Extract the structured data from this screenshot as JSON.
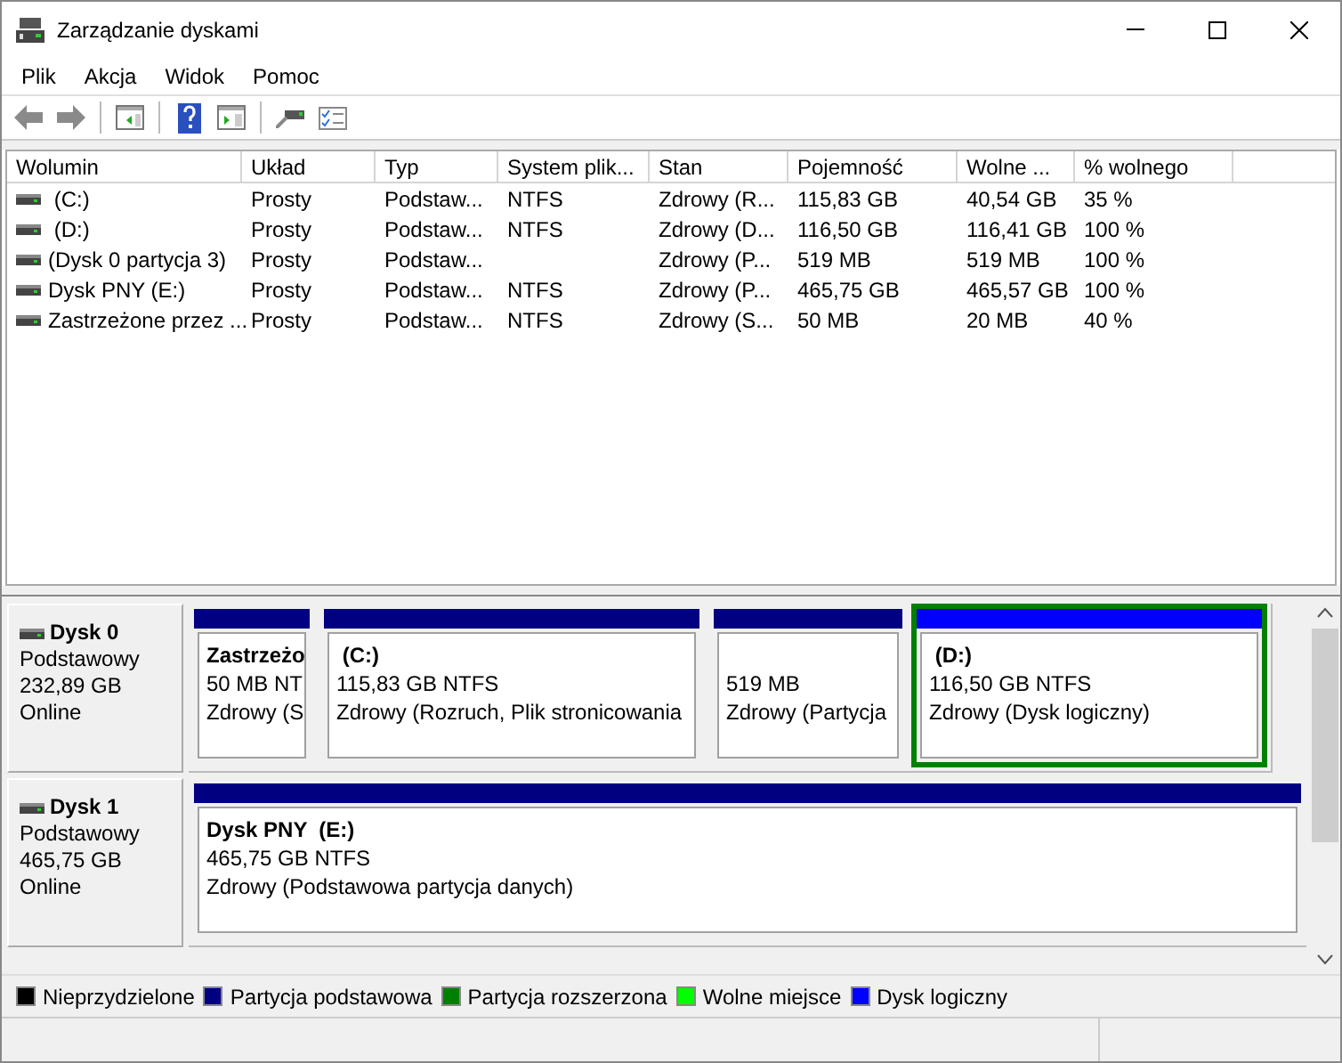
{
  "window": {
    "title": "Zarządzanie dyskami"
  },
  "menu": [
    "Plik",
    "Akcja",
    "Widok",
    "Pomoc"
  ],
  "table": {
    "columns": [
      "Wolumin",
      "Układ",
      "Typ",
      "System plik...",
      "Stan",
      "Pojemność",
      "Wolne ...",
      "% wolnego"
    ],
    "rows": [
      {
        "volume": " (C:)",
        "layout": "Prosty",
        "type": "Podstaw...",
        "file_system": "NTFS",
        "status": "Zdrowy (R...",
        "capacity": "115,83 GB",
        "free": "40,54 GB",
        "free_percent": "35 %"
      },
      {
        "volume": " (D:)",
        "layout": "Prosty",
        "type": "Podstaw...",
        "file_system": "NTFS",
        "status": "Zdrowy (D...",
        "capacity": "116,50 GB",
        "free": "116,41 GB",
        "free_percent": "100 %"
      },
      {
        "volume": "(Dysk 0 partycja 3)",
        "layout": "Prosty",
        "type": "Podstaw...",
        "status": "Zdrowy (P...",
        "capacity": "519 MB",
        "free": "519 MB",
        "free_percent": "100 %"
      },
      {
        "volume": "Dysk PNY (E:)",
        "layout": "Prosty",
        "type": "Podstaw...",
        "file_system": "NTFS",
        "status": "Zdrowy (P...",
        "capacity": "465,75 GB",
        "free": "465,57 GB",
        "free_percent": "100 %"
      },
      {
        "volume": "Zastrzeżone przez ...",
        "layout": "Prosty",
        "type": "Podstaw...",
        "file_system": "NTFS",
        "status": "Zdrowy (S...",
        "capacity": "50 MB",
        "free": "20 MB",
        "free_percent": "40 %"
      }
    ]
  },
  "disks": [
    {
      "name": "Dysk 0",
      "type": "Podstawowy",
      "size": "232,89 GB",
      "status": "Online",
      "partitions": [
        {
          "label": "Zastrzeżo",
          "size": "50 MB NT",
          "status": "Zdrowy (S",
          "color": "#000080",
          "selected": false
        },
        {
          "label": " (C:)",
          "size": "115,83 GB NTFS",
          "status": "Zdrowy (Rozruch, Plik stronicowania",
          "color": "#000080",
          "selected": false
        },
        {
          "size": "519 MB",
          "status": "Zdrowy (Partycja",
          "color": "#000080",
          "selected": false
        },
        {
          "label": " (D:)",
          "size": "116,50 GB NTFS",
          "status": "Zdrowy (Dysk logiczny)",
          "color": "#0000ff",
          "selected": true
        }
      ]
    },
    {
      "name": "Dysk 1",
      "type": "Podstawowy",
      "size": "465,75 GB",
      "status": "Online",
      "partitions": [
        {
          "label": "Dysk PNY  (E:)",
          "size": "465,75 GB NTFS",
          "status": "Zdrowy (Podstawowa partycja danych)",
          "color": "#000080",
          "selected": false
        }
      ]
    }
  ],
  "legend": [
    {
      "label": "Nieprzydzielone",
      "color": "#000000"
    },
    {
      "label": "Partycja podstawowa",
      "color": "#000080"
    },
    {
      "label": "Partycja rozszerzona",
      "color": "#008000"
    },
    {
      "label": "Wolne miejsce",
      "color": "#00ff00"
    },
    {
      "label": "Dysk logiczny",
      "color": "#0000ff"
    }
  ]
}
